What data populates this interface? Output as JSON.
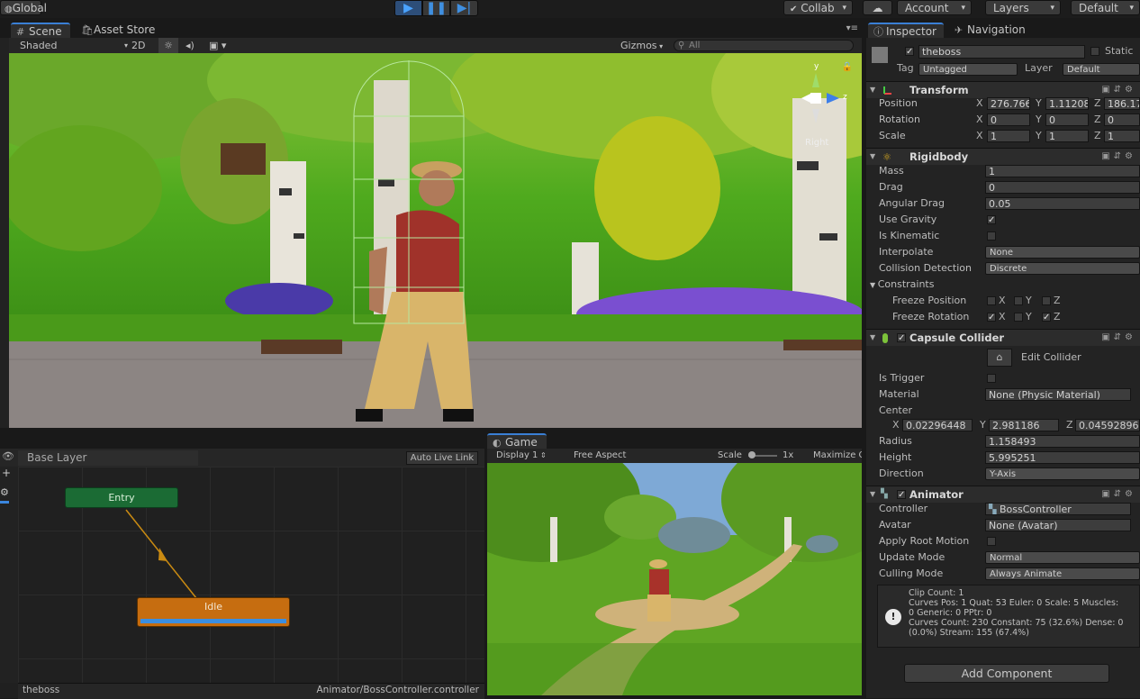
{
  "toolbar": {
    "global_label": "Global",
    "collab_label": "Collab",
    "account_label": "Account",
    "layers_label": "Layers",
    "layout_label": "Default"
  },
  "scene_tabs": {
    "scene": "Scene",
    "asset_store": "Asset Store"
  },
  "scene_toolbar": {
    "shading": "Shaded",
    "mode_2d": "2D",
    "gizmos": "Gizmos",
    "search_placeholder": "All"
  },
  "scene_view": {
    "gizmo_label": "Right",
    "axis_y": "y",
    "axis_z": "z"
  },
  "inspector": {
    "tabs": {
      "inspector": "Inspector",
      "navigation": "Navigation"
    },
    "object_name": "theboss",
    "static_label": "Static",
    "tag_label": "Tag",
    "tag_value": "Untagged",
    "layer_label": "Layer",
    "layer_value": "Default",
    "transform": {
      "title": "Transform",
      "position_label": "Position",
      "rotation_label": "Rotation",
      "scale_label": "Scale",
      "position": {
        "x": "276.766",
        "y": "1.11208",
        "z": "186.17"
      },
      "rotation": {
        "x": "0",
        "y": "0",
        "z": "0"
      },
      "scale": {
        "x": "1",
        "y": "1",
        "z": "1"
      }
    },
    "rigidbody": {
      "title": "Rigidbody",
      "mass_label": "Mass",
      "mass": "1",
      "drag_label": "Drag",
      "drag": "0",
      "angular_drag_label": "Angular Drag",
      "angular_drag": "0.05",
      "use_gravity_label": "Use Gravity",
      "is_kinematic_label": "Is Kinematic",
      "interpolate_label": "Interpolate",
      "interpolate": "None",
      "collision_label": "Collision Detection",
      "collision": "Discrete",
      "constraints_label": "Constraints",
      "freeze_position_label": "Freeze Position",
      "freeze_rotation_label": "Freeze Rotation"
    },
    "capsule": {
      "title": "Capsule Collider",
      "edit_collider": "Edit Collider",
      "is_trigger_label": "Is Trigger",
      "material_label": "Material",
      "material": "None (Physic Material)",
      "center_label": "Center",
      "center": {
        "x": "0.02296448",
        "y": "2.981186",
        "z": "0.04592896"
      },
      "radius_label": "Radius",
      "radius": "1.158493",
      "height_label": "Height",
      "height": "5.995251",
      "direction_label": "Direction",
      "direction": "Y-Axis"
    },
    "animator": {
      "title": "Animator",
      "controller_label": "Controller",
      "controller": "BossController",
      "avatar_label": "Avatar",
      "avatar": "None (Avatar)",
      "root_motion_label": "Apply Root Motion",
      "update_mode_label": "Update Mode",
      "update_mode": "Normal",
      "culling_label": "Culling Mode",
      "culling": "Always Animate",
      "info_lines": [
        "Clip Count: 1",
        "Curves Pos: 1 Quat: 53 Euler: 0 Scale: 5 Muscles:",
        "0 Generic: 0 PPtr: 0",
        "Curves Count: 230 Constant: 75 (32.6%) Dense: 0",
        "(0.0%) Stream: 155 (67.4%)"
      ]
    },
    "add_component": "Add Component",
    "axis": {
      "x": "X",
      "y": "Y",
      "z": "Z"
    }
  },
  "animator_panel": {
    "layer_tab": "Base Layer",
    "auto_live_link": "Auto Live Link",
    "entry_state": "Entry",
    "idle_state": "Idle",
    "footer_left": "theboss",
    "footer_right": "Animator/BossController.controller"
  },
  "game_panel": {
    "tab": "Game",
    "display": "Display 1",
    "aspect": "Free Aspect",
    "scale_label": "Scale",
    "scale_value": "1x",
    "maximize": "Maximize O"
  }
}
